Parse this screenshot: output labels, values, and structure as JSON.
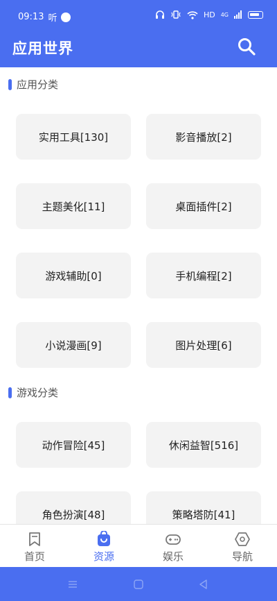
{
  "status_bar": {
    "time": "09:13",
    "carrier_glyph": "听",
    "network": "HD",
    "signal_label": "4G"
  },
  "app_bar": {
    "title": "应用世界",
    "search_icon": "search-icon"
  },
  "sections": [
    {
      "title": "应用分类",
      "tiles": [
        "实用工具[130]",
        "影音播放[2]",
        "主题美化[11]",
        "桌面插件[2]",
        "游戏辅助[0]",
        "手机编程[2]",
        "小说漫画[9]",
        "图片处理[6]"
      ]
    },
    {
      "title": "游戏分类",
      "tiles": [
        "动作冒险[45]",
        "休闲益智[516]",
        "角色扮演[48]",
        "策略塔防[41]"
      ]
    }
  ],
  "bottom_nav": [
    {
      "label": "首页",
      "icon": "bookmark-icon",
      "active": false
    },
    {
      "label": "资源",
      "icon": "bag-icon",
      "active": true
    },
    {
      "label": "娱乐",
      "icon": "gamepad-icon",
      "active": false
    },
    {
      "label": "导航",
      "icon": "hexagon-icon",
      "active": false
    }
  ],
  "colors": {
    "primary": "#4a6ef0",
    "tile_bg": "#f3f3f3",
    "text": "#222222"
  }
}
